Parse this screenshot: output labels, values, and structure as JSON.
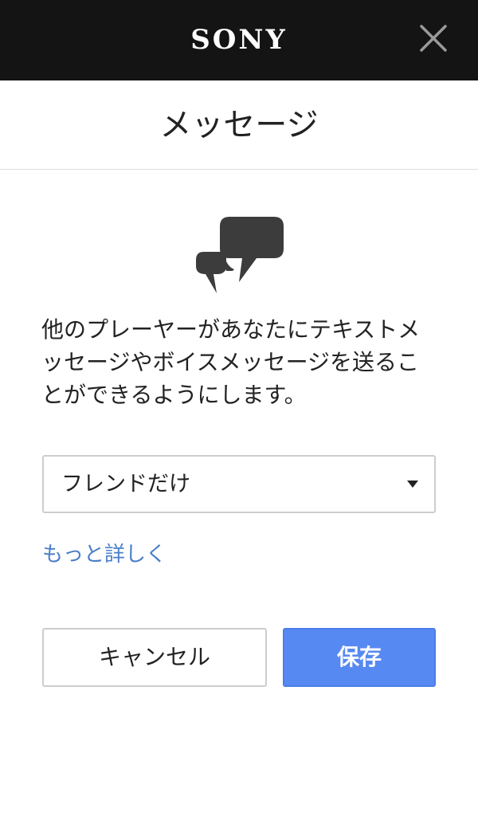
{
  "header": {
    "brand": "SONY",
    "close_icon": "close-icon",
    "background_color": "#141414"
  },
  "dialog": {
    "title": "メッセージ",
    "icon": "chat-bubbles-icon",
    "description": "他のプレーヤーがあなたにテキストメッセージやボイスメッセージを送ることができるようにします。",
    "select": {
      "selected_value": "フレンドだけ",
      "caret_icon": "caret-down-icon"
    },
    "learn_more_label": "もっと詳しく",
    "cancel_label": "キャンセル",
    "save_label": "保存"
  },
  "colors": {
    "link": "#4a7ec8",
    "primary_button": "#5789f2"
  }
}
